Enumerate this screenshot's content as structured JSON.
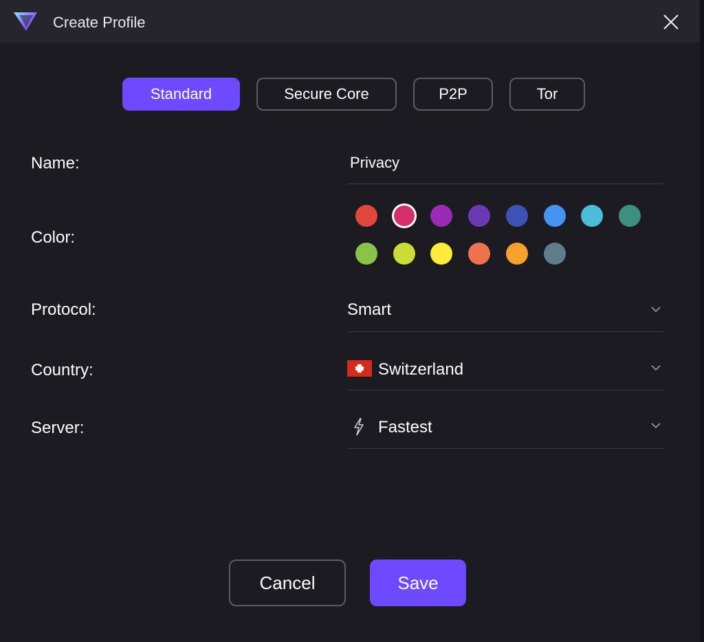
{
  "titlebar": {
    "title": "Create Profile",
    "logo_icon": "protonvpn-logo-icon",
    "close_icon": "close-icon"
  },
  "tabs": [
    {
      "label": "Standard",
      "active": true
    },
    {
      "label": "Secure Core",
      "active": false
    },
    {
      "label": "P2P",
      "active": false
    },
    {
      "label": "Tor",
      "active": false
    }
  ],
  "form": {
    "name": {
      "label": "Name:",
      "value": "Privacy"
    },
    "color": {
      "label": "Color:",
      "swatches": [
        {
          "color": "#e0463b",
          "selected": false
        },
        {
          "color": "#d5306a",
          "selected": true
        },
        {
          "color": "#9c2bb4",
          "selected": false
        },
        {
          "color": "#6a3ab5",
          "selected": false
        },
        {
          "color": "#3f51b5",
          "selected": false
        },
        {
          "color": "#4693f3",
          "selected": false
        },
        {
          "color": "#4bbdd8",
          "selected": false
        },
        {
          "color": "#3d9080",
          "selected": false
        },
        {
          "color": "#8bc34a",
          "selected": false
        },
        {
          "color": "#cddc39",
          "selected": false
        },
        {
          "color": "#ffeb3b",
          "selected": false
        },
        {
          "color": "#f0734f",
          "selected": false
        },
        {
          "color": "#f7a02b",
          "selected": false
        },
        {
          "color": "#607d8b",
          "selected": false
        }
      ]
    },
    "protocol": {
      "label": "Protocol:",
      "value": "Smart"
    },
    "country": {
      "label": "Country:",
      "value": "Switzerland",
      "flag_icon": "switzerland-flag-icon"
    },
    "server": {
      "label": "Server:",
      "value": "Fastest",
      "icon": "lightning-bolt-icon"
    }
  },
  "buttons": {
    "cancel_label": "Cancel",
    "save_label": "Save"
  },
  "colors": {
    "accent": "#6d4aff",
    "background": "#1c1b22",
    "titlebar": "#26252d",
    "border": "#5b5a66"
  }
}
